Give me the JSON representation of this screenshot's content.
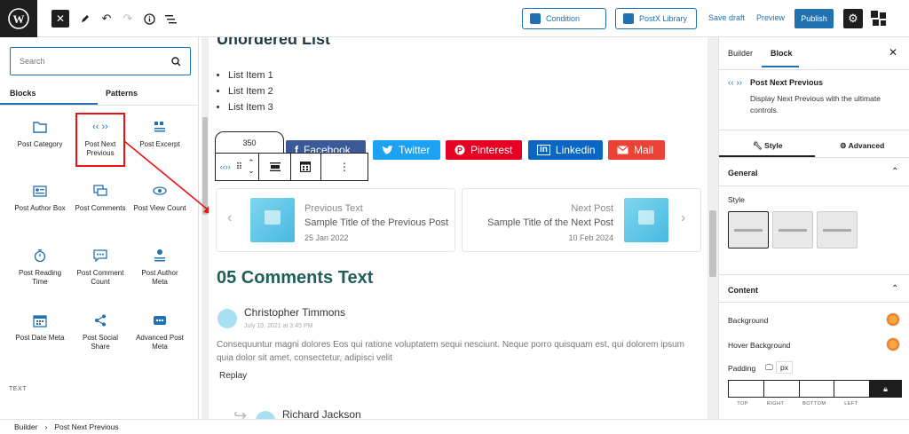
{
  "topbar": {
    "condition_label": "Condition",
    "postx_library_label": "PostX Library",
    "save_draft_label": "Save draft",
    "preview_label": "Preview",
    "publish_label": "Publish"
  },
  "inserter": {
    "search_placeholder": "Search",
    "tabs": [
      "Blocks",
      "Patterns"
    ],
    "blocks": [
      {
        "label": "Post Category",
        "icon": "folder-icon"
      },
      {
        "label": "Post Next Previous",
        "icon": "chevrons-icon"
      },
      {
        "label": "Post Excerpt",
        "icon": "quote-icon"
      },
      {
        "label": "Post Author Box",
        "icon": "author-card-icon"
      },
      {
        "label": "Post Comments",
        "icon": "comments-icon"
      },
      {
        "label": "Post View Count",
        "icon": "eye-icon"
      },
      {
        "label": "Post Reading Time",
        "icon": "stopwatch-icon"
      },
      {
        "label": "Post Comment Count",
        "icon": "comment-count-icon"
      },
      {
        "label": "Post Author Meta",
        "icon": "author-meta-icon"
      },
      {
        "label": "Post Date Meta",
        "icon": "calendar-icon"
      },
      {
        "label": "Post Social Share",
        "icon": "share-icon"
      },
      {
        "label": "Advanced Post Meta",
        "icon": "meta-dots-icon"
      }
    ],
    "section_label": "TEXT"
  },
  "canvas": {
    "heading": "Unordered List",
    "list_items": [
      "List Item 1",
      "List Item 2",
      "List Item 3"
    ],
    "share_count": "350",
    "social": [
      {
        "label": "Facebook",
        "color": "#3b5998"
      },
      {
        "label": "Twitter",
        "color": "#1da1f2"
      },
      {
        "label": "Pinterest",
        "color": "#e60023"
      },
      {
        "label": "Linkedin",
        "color": "#0a66c2"
      },
      {
        "label": "Mail",
        "color": "#ea4335"
      }
    ],
    "prev": {
      "label": "Previous Text",
      "title": "Sample Title of the Previous Post",
      "date": "25 Jan 2022"
    },
    "next": {
      "label": "Next Post",
      "title": "Sample Title of the Next Post",
      "date": "10 Feb 2024"
    },
    "comments_heading": "05 Comments Text",
    "comment1": {
      "author": "Christopher Timmons",
      "date": "July 19, 2021 at 3:45 PM",
      "text": "Consequuntur magni dolores Eos qui ratione voluptatem sequi nesciunt. Neque porro quisquam est, qui dolorem ipsum quia dolor sit amet, consectetur, adipisci velit",
      "reply": "Replay"
    },
    "comment2": {
      "author": "Richard Jackson"
    }
  },
  "panel": {
    "tabs": [
      "Builder",
      "Block"
    ],
    "block_title": "Post Next Previous",
    "block_desc": "Display Next Previous with the ultimate controls.",
    "style_tabs": [
      "Style",
      "Advanced"
    ],
    "general_label": "General",
    "style_label": "Style",
    "content_label": "Content",
    "background_label": "Background",
    "hover_background_label": "Hover Background",
    "padding_label": "Padding",
    "unit": "px",
    "padding_sides": [
      "TOP",
      "RIGHT",
      "BOTTOM",
      "LEFT"
    ]
  },
  "footer": {
    "breadcrumb": [
      "Builder",
      "Post Next Previous"
    ]
  }
}
